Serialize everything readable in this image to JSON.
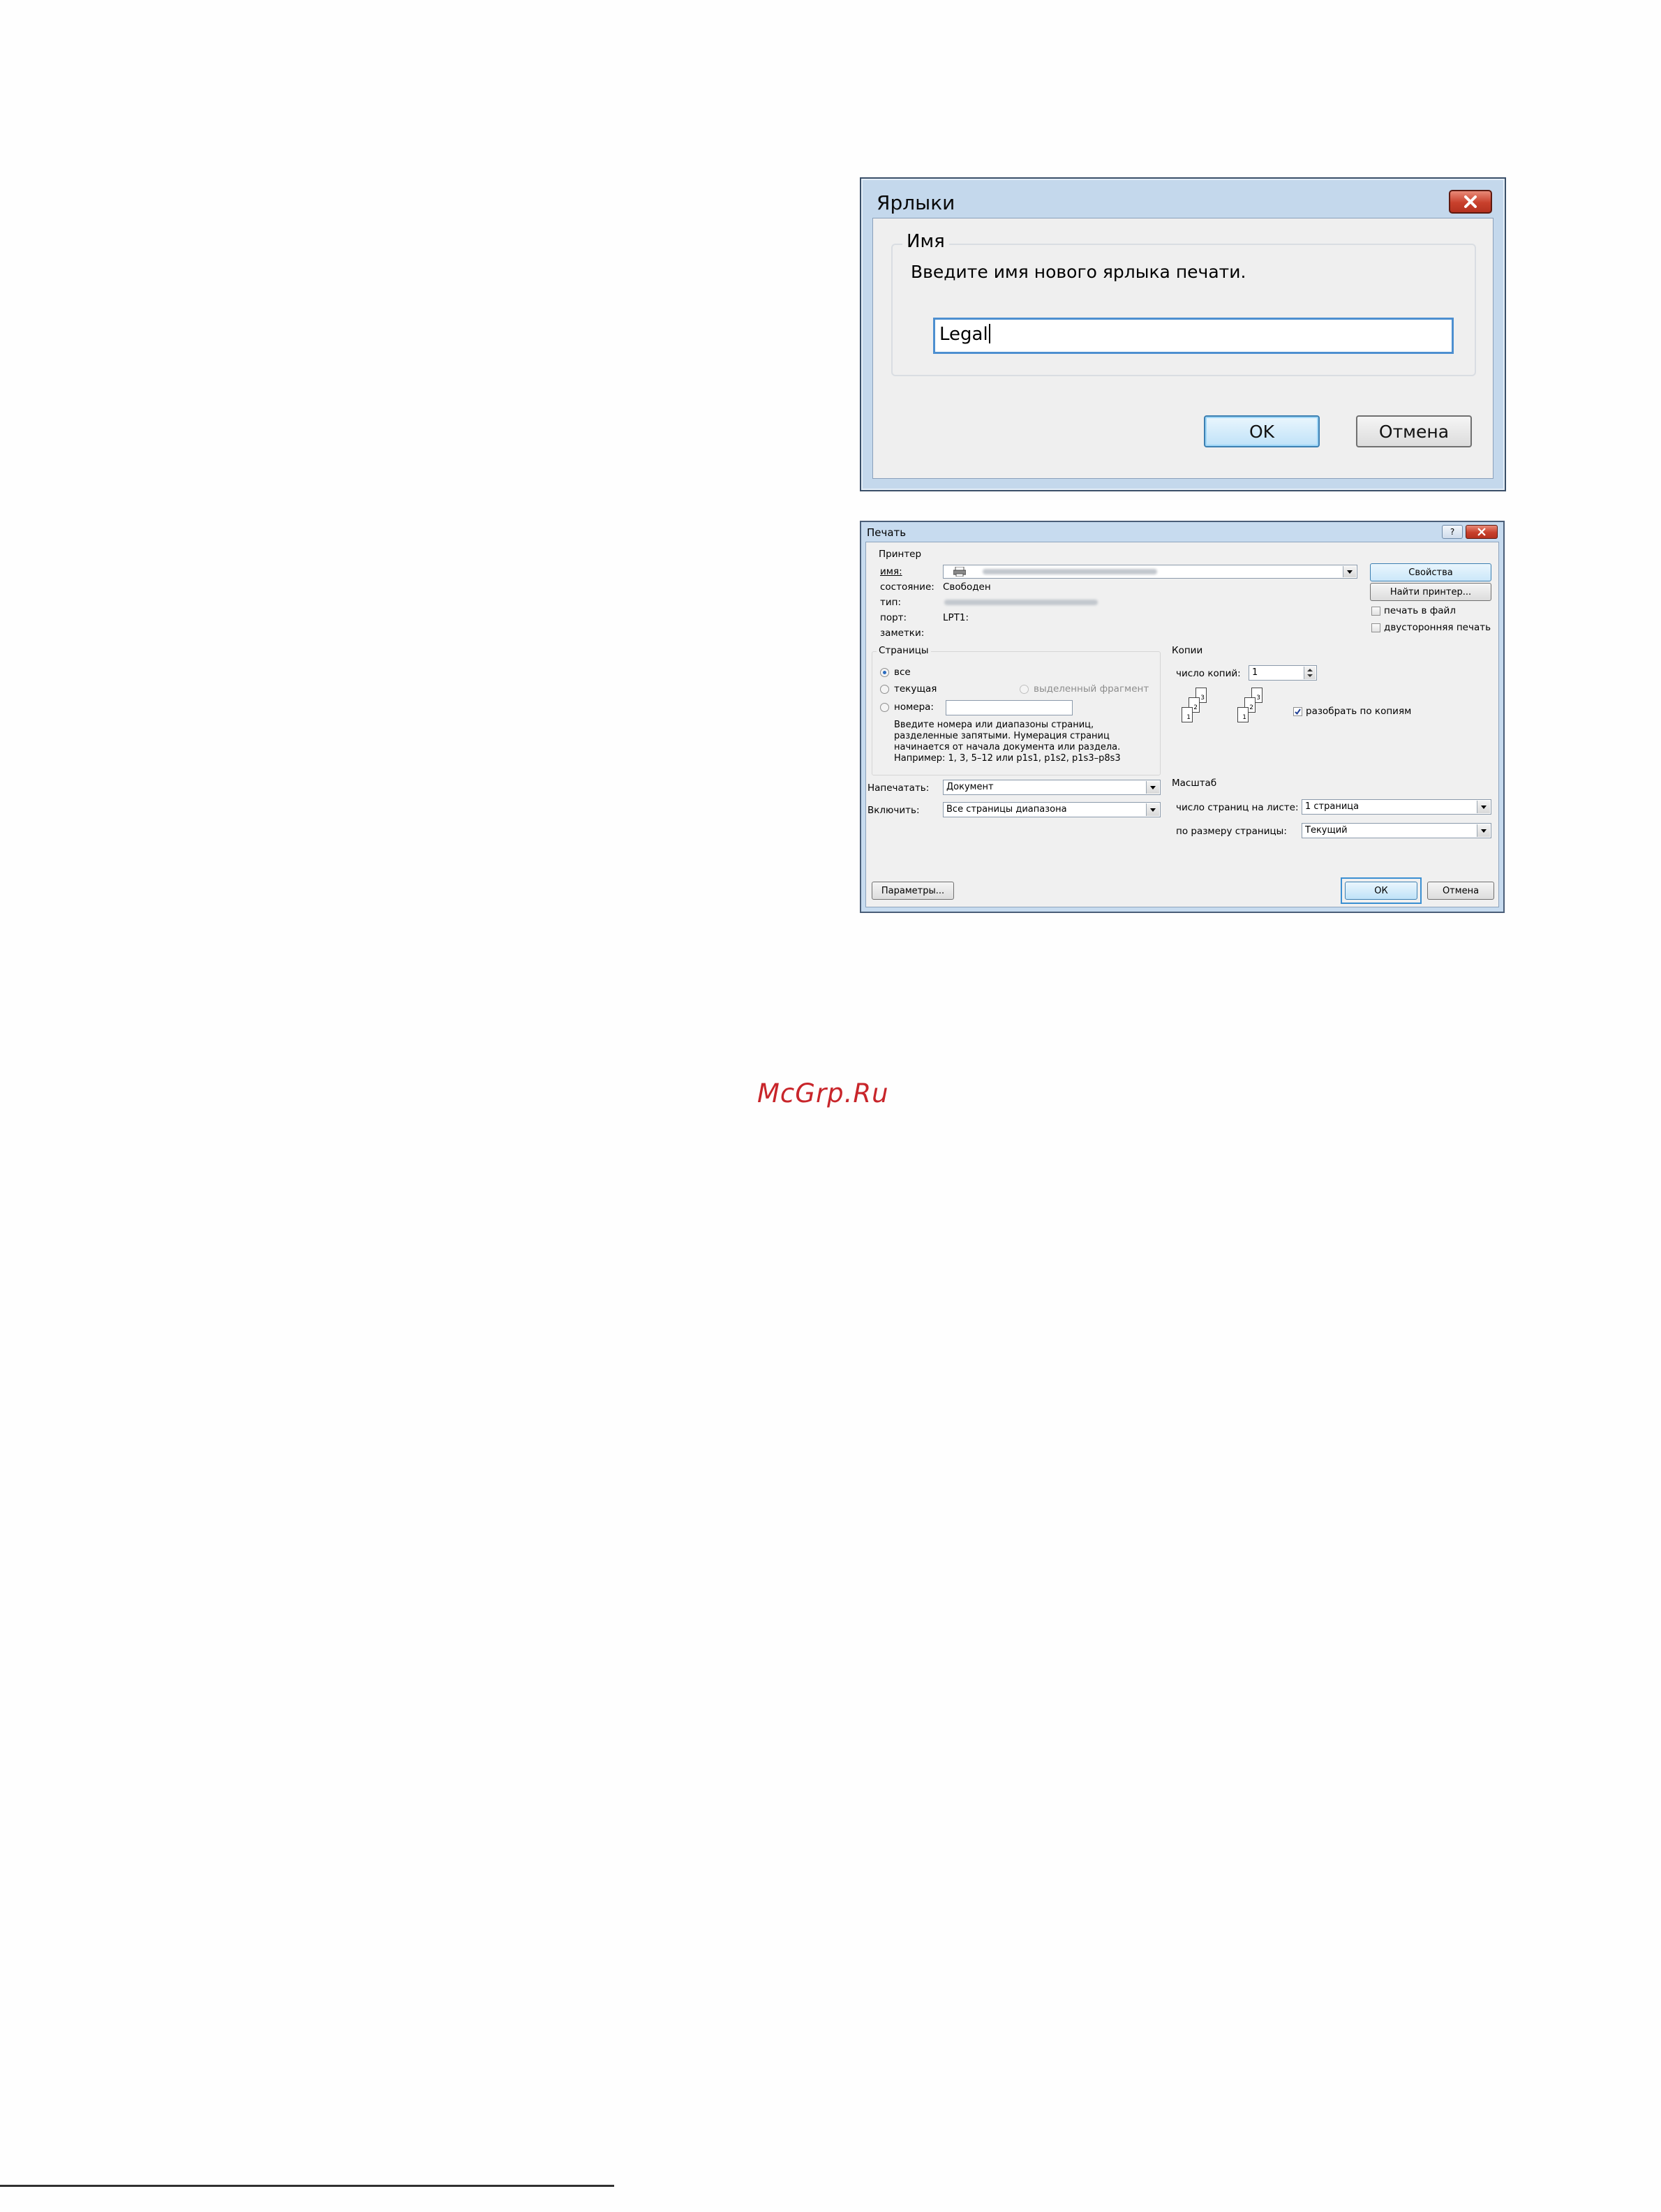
{
  "labels_dialog": {
    "title": "Ярлыки",
    "group_label": "Имя",
    "prompt": "Введите имя нового ярлыка печати.",
    "name_value": "Legal",
    "ok_label": "OK",
    "cancel_label": "Отмена"
  },
  "print_dialog": {
    "title": "Печать",
    "help_label": "?",
    "printer": {
      "group_label": "Принтер",
      "name_label": "имя:",
      "status_label": "состояние:",
      "status_value": "Свободен",
      "type_label": "тип:",
      "port_label": "порт:",
      "port_value": "LPT1:",
      "notes_label": "заметки:",
      "properties_button": "Свойства",
      "find_printer_button": "Найти принтер...",
      "print_to_file_label": "печать в файл",
      "duplex_label": "двусторонняя печать"
    },
    "pages": {
      "group_label": "Страницы",
      "all_label": "все",
      "current_label": "текущая",
      "selection_label": "выделенный фрагмент",
      "numbers_label": "номера:",
      "hint": [
        "Введите номера или диапазоны страниц,",
        "разделенные запятыми. Нумерация страниц",
        "начинается от начала документа или раздела.",
        "Например: 1, 3, 5–12 или p1s1, p1s2, p1s3–p8s3"
      ]
    },
    "copies": {
      "group_label": "Копии",
      "count_label": "число копий:",
      "count_value": "1",
      "collate_label": "разобрать по копиям"
    },
    "print_what_label": "Напечатать:",
    "print_what_value": "Документ",
    "include_label": "Включить:",
    "include_value": "Все страницы диапазона",
    "zoom": {
      "group_label": "Масштаб",
      "pages_per_sheet_label": "число страниц на листе:",
      "pages_per_sheet_value": "1 страница",
      "scale_to_label": "по размеру страницы:",
      "scale_to_value": "Текущий"
    },
    "options_button": "Параметры...",
    "ok_label": "ОК",
    "cancel_label": "Отмена"
  },
  "watermark": "McGrp.Ru"
}
